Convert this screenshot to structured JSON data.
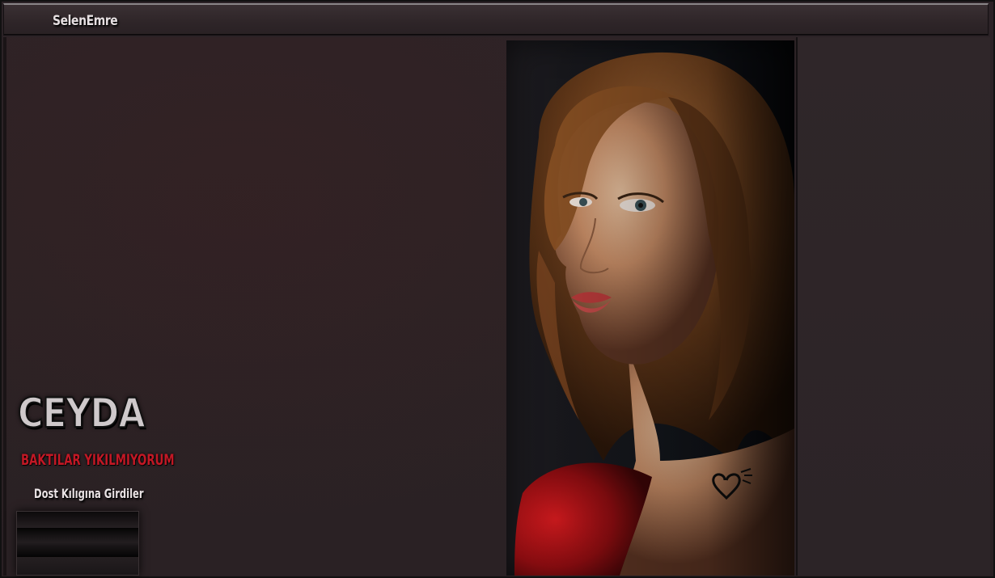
{
  "header": {
    "title": "SelenEmre"
  },
  "logo": {
    "title": "CEYDA",
    "subtitle": "BAKTILAR YIKILMIYORUM",
    "tagline": "Dost Kılıgına Girdiler"
  },
  "portrait": {
    "icon": "heart-signature-icon"
  },
  "colors": {
    "background": "#2a2124",
    "accent_red": "#c21825",
    "text_light": "#e6dfe1"
  }
}
